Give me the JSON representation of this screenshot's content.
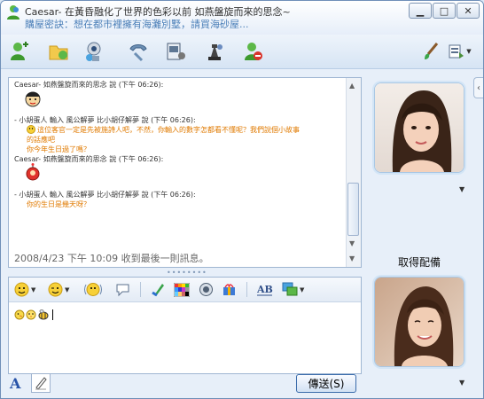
{
  "window": {
    "title": "Caesar- 在黃昏融化了世界的色彩以前 如燕盤旋而來的思念~",
    "subtitle": "購屋密訣：想在都市裡擁有海灘別墅，請買海砂屋..."
  },
  "window_buttons": [
    "minimize",
    "maximize",
    "close"
  ],
  "toolbar": {
    "icons": [
      "invite-contact-icon",
      "send-files-icon",
      "video-call-icon",
      "phone-call-icon",
      "activities-icon",
      "games-icon",
      "block-icon",
      "background-brush-icon",
      "view-options-icon"
    ]
  },
  "chat": {
    "messages": [
      {
        "sender": "Caesar- 如燕盤旋而來的思念 說 (下午 06:26):",
        "lines": []
      },
      {
        "sender": "- 小胡蛋人 輸入 風公解夢 比小胡仔解夢 說 (下午 06:26):",
        "lines": [
          "這位客官一定是先被施詩人吧，不然，你輸入的數字怎都看不懂呢？我們說個小故事",
          "的話應吧",
          "你今年生日過了嗎？"
        ]
      },
      {
        "sender": "Caesar- 如燕盤旋而來的思念 說 (下午 06:26):",
        "lines": []
      },
      {
        "sender": "- 小胡蛋人 輸入 風公解夢 比小胡仔解夢 說 (下午 06:26):",
        "lines": [
          "你的生日是幾天呀？"
        ]
      }
    ],
    "last_received": "2008/4/23 下午 10:09 收到最後一則訊息。"
  },
  "input": {
    "emoticons": [
      "duck-emoticon",
      "chick-emoticon",
      "bee-emoticon"
    ]
  },
  "side": {
    "get_avatar_label": "取得配備"
  },
  "send_button_label": "傳送(S)"
}
